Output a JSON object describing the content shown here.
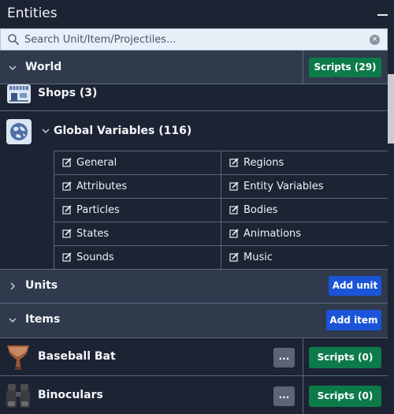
{
  "panel": {
    "title": "Entities",
    "minimize_icon": "minimize-icon"
  },
  "search": {
    "placeholder": "Search Unit/Item/Projectiles...",
    "value": "",
    "icon": "search-icon",
    "clear_icon": "clear-icon",
    "clear_glyph": "×"
  },
  "world": {
    "label": "World",
    "scripts_button": "Scripts (29)",
    "shops": {
      "label": "Shops (3)",
      "icon": "shop-icon"
    },
    "global_variables": {
      "label": "Global Variables (116)",
      "icon": "globe-icon",
      "items": [
        {
          "label": "General"
        },
        {
          "label": "Regions"
        },
        {
          "label": "Attributes"
        },
        {
          "label": "Entity Variables"
        },
        {
          "label": "Particles"
        },
        {
          "label": "Bodies"
        },
        {
          "label": "States"
        },
        {
          "label": "Animations"
        },
        {
          "label": "Sounds"
        },
        {
          "label": "Music"
        }
      ]
    }
  },
  "units": {
    "label": "Units",
    "add_button": "Add unit"
  },
  "items": {
    "label": "Items",
    "add_button": "Add item",
    "list": [
      {
        "name": "Baseball Bat",
        "icon": "baseball-bat-icon",
        "more_label": "...",
        "scripts_label": "Scripts (0)"
      },
      {
        "name": "Binoculars",
        "icon": "binoculars-icon",
        "more_label": "...",
        "scripts_label": "Scripts (0)"
      }
    ]
  },
  "colors": {
    "background": "#1c2333",
    "section_header": "#2f3a4d",
    "scripts_green": "#0d7a4a",
    "add_blue": "#1b54d8",
    "more_gray": "#5b6577"
  }
}
